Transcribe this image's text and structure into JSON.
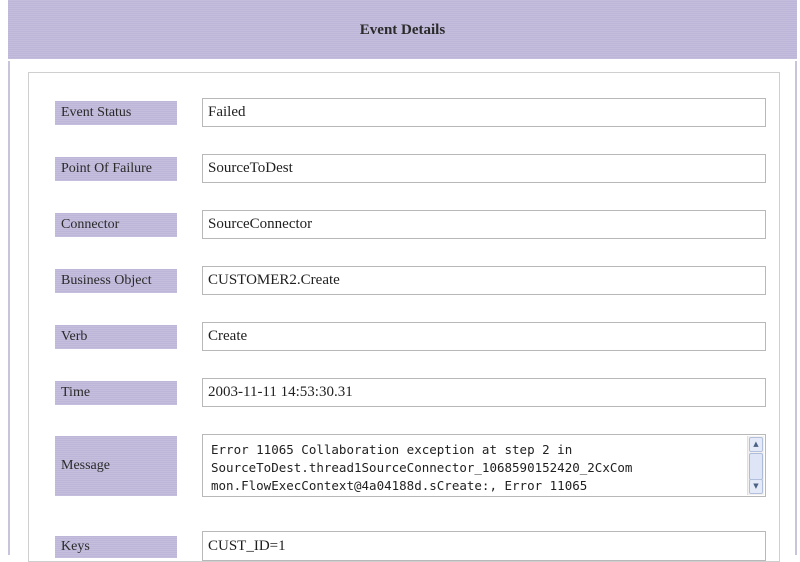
{
  "header": {
    "title": "Event Details"
  },
  "rows": [
    {
      "label": "Event Status",
      "value": "Failed"
    },
    {
      "label": "Point Of Failure",
      "value": "SourceToDest"
    },
    {
      "label": "Connector",
      "value": "SourceConnector"
    },
    {
      "label": "Business Object",
      "value": "CUSTOMER2.Create"
    },
    {
      "label": "Verb",
      "value": "Create"
    },
    {
      "label": "Time",
      "value": "2003-11-11 14:53:30.31"
    }
  ],
  "message": {
    "label": "Message",
    "lines": [
      "Error 11065 Collaboration exception at step 2 in",
      "SourceToDest.thread1SourceConnector_1068590152420_2CxCom",
      "mon.FlowExecContext@4a04188d.sCreate:, Error 11065"
    ]
  },
  "keys": {
    "label": "Keys",
    "value": "CUST_ID=1"
  },
  "icons": {
    "scroll_up": "arrow-up-icon",
    "scroll_down": "arrow-down-icon"
  }
}
